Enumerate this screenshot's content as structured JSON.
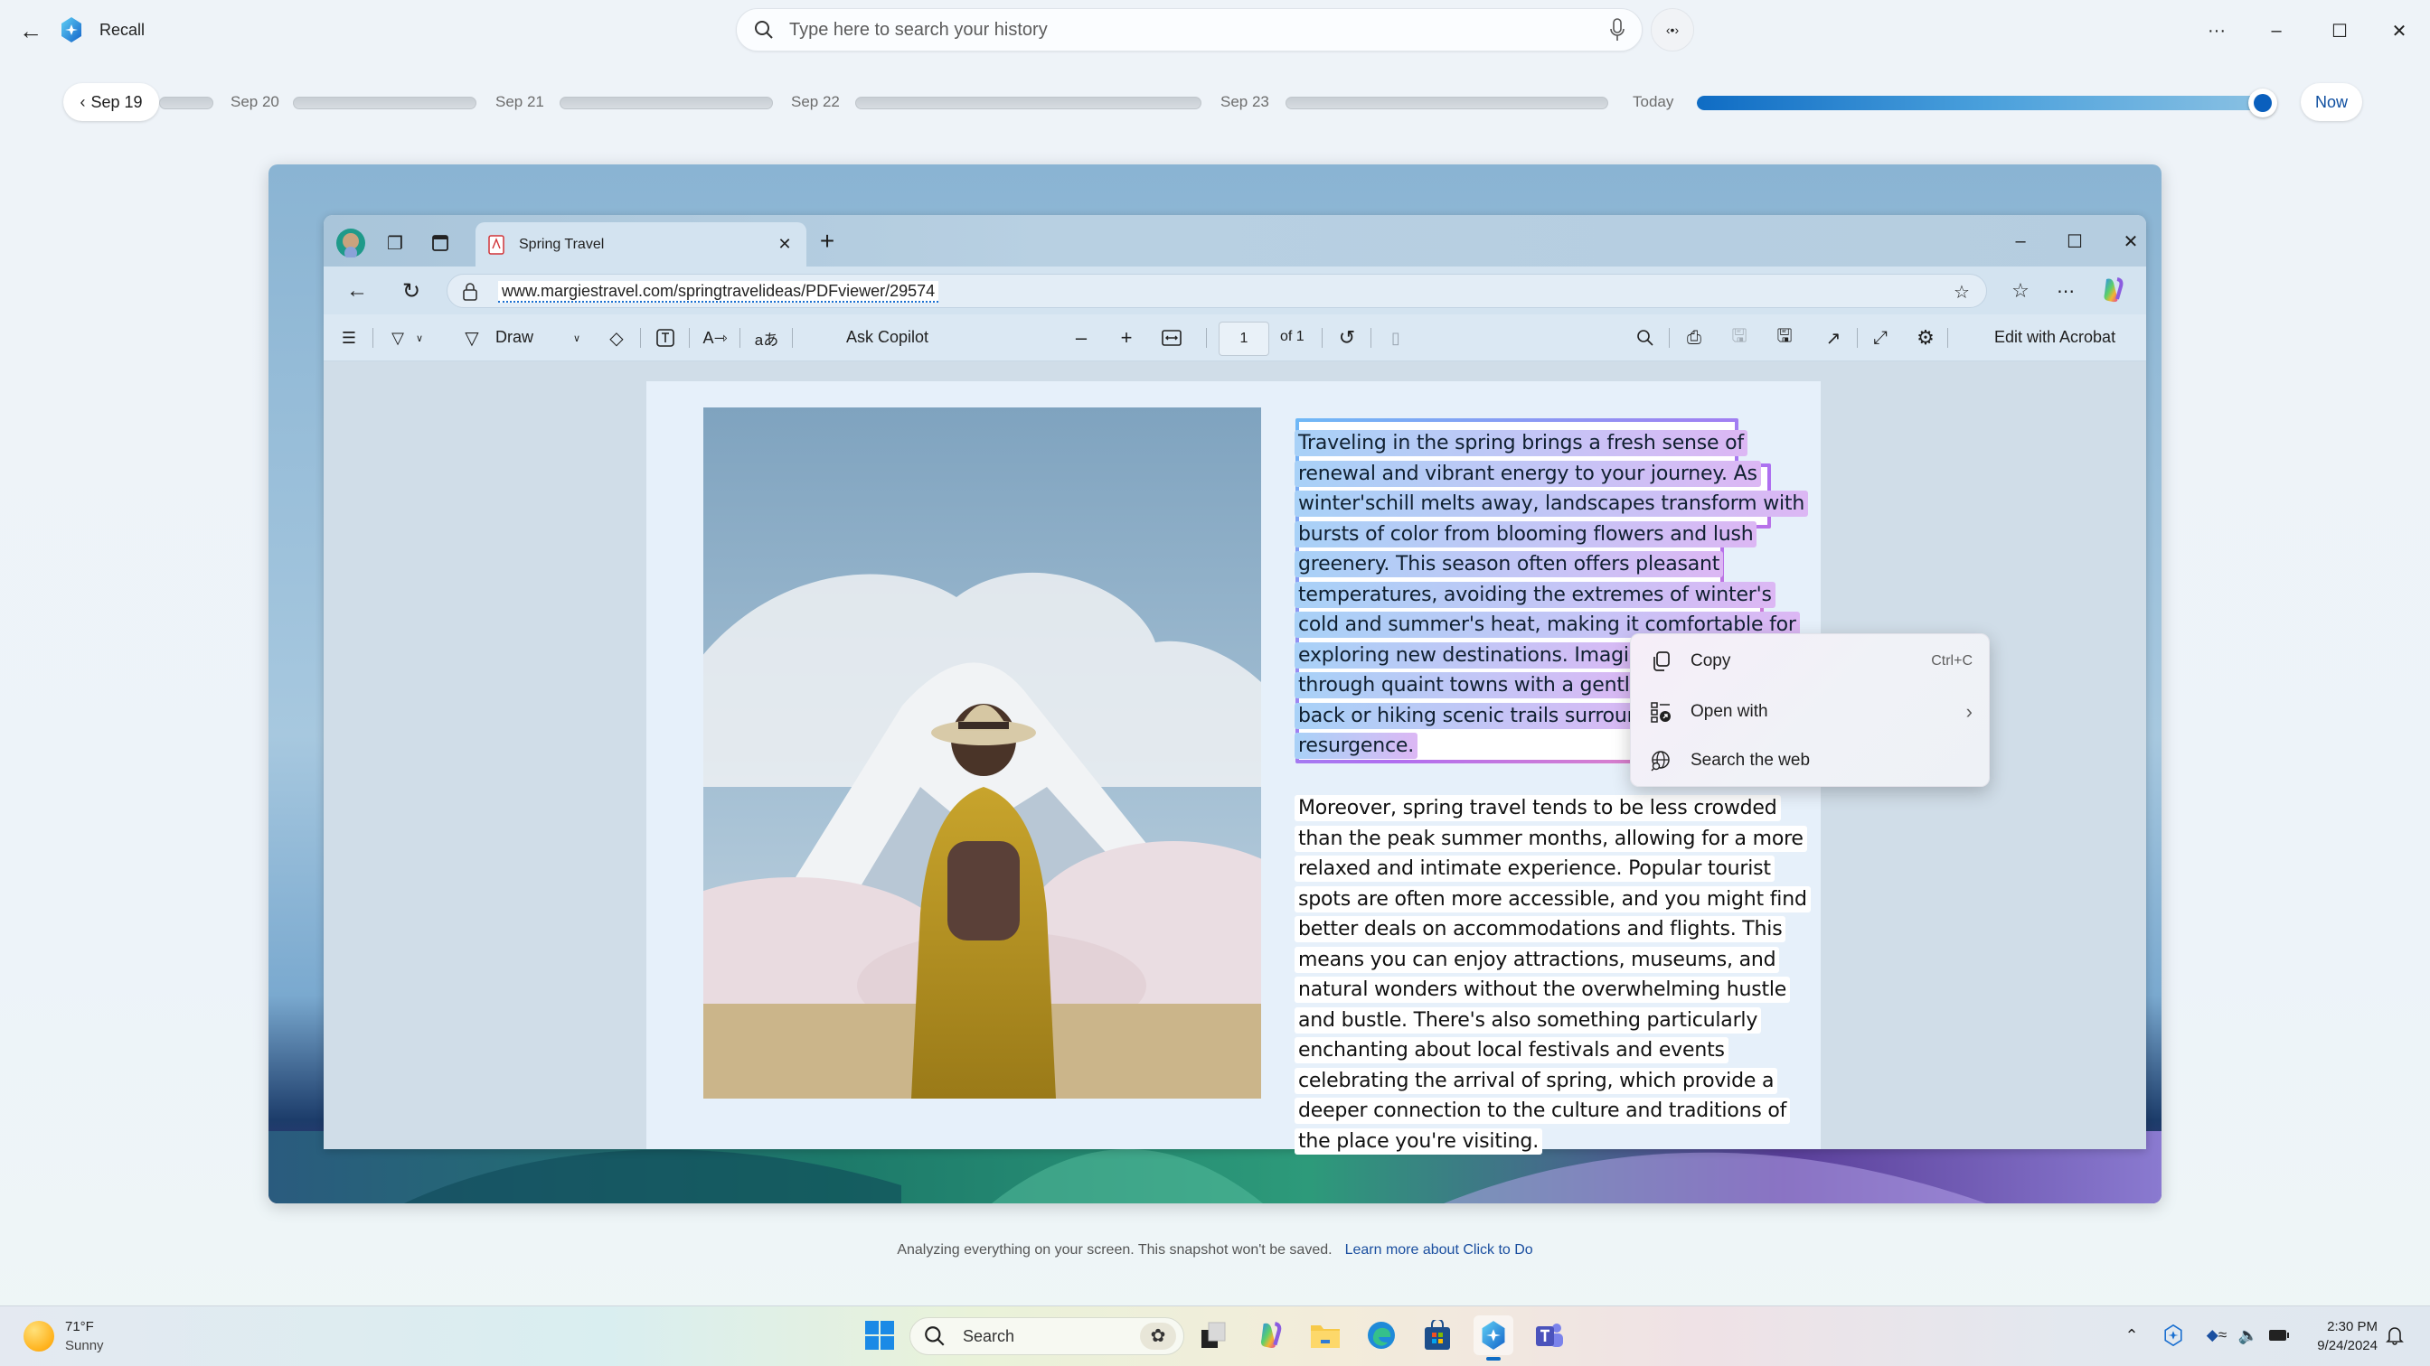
{
  "app": {
    "title": "Recall",
    "back_icon": "arrow-left-icon",
    "logo_icon": "recall-logo-icon"
  },
  "search": {
    "placeholder": "Type here to search your history",
    "value": "",
    "search_icon": "search-icon",
    "mic_icon": "microphone-icon"
  },
  "title_controls": {
    "code_button_icon": "code-brackets-icon",
    "more": "···",
    "minimize": "–",
    "maximize": "☐",
    "close": "✕"
  },
  "timeline": {
    "back_button": "Sep 19",
    "labels": [
      "Sep 20",
      "Sep 21",
      "Sep 22",
      "Sep 23",
      "Today"
    ],
    "today_progress_percent": 100,
    "now_button": "Now"
  },
  "browser": {
    "tab": {
      "title": "Spring Travel",
      "icon": "pdf-file-icon"
    },
    "new_tab": "+",
    "window_controls": {
      "minimize": "–",
      "maximize": "☐",
      "close": "✕"
    },
    "address": {
      "url": "www.margiestravel.com/springtravelideas/PDFviewer/29574"
    },
    "pdf_toolbar": {
      "draw_label": "Draw",
      "ask_copilot_label": "Ask Copilot",
      "zoom_out": "–",
      "zoom_in": "+",
      "page_current": "1",
      "page_total": "of 1",
      "edit_label": "Edit with Acrobat"
    }
  },
  "document": {
    "image_alt": "Traveler with yellow coat and backpack facing a snow-capped mountain behind cherry blossoms",
    "selected_paragraph_lines": [
      "Traveling in the spring brings a fresh sense of",
      "renewal and vibrant energy to your journey. As",
      "winter'schill melts away, landscapes transform with",
      "bursts of color from blooming flowers and lush",
      "greenery. This season often offers pleasant",
      "temperatures, avoiding the extremes of winter's",
      "cold and summer's heat, making it comfortable for",
      "exploring new destinations. Imagine",
      "through quaint towns with a gentle",
      "back or hiking scenic trails surround",
      "resurgence."
    ],
    "second_paragraph_lines": [
      "Moreover, spring travel tends to be less crowded",
      "than the peak summer months, allowing for a more",
      "relaxed and intimate experience. Popular tourist",
      "spots are often more accessible, and you might find",
      "better deals on accommodations and flights. This",
      "means you can enjoy attractions, museums, and",
      "natural wonders without the overwhelming hustle",
      "and bustle. There's also something particularly",
      "enchanting about local festivals and events",
      "celebrating the arrival of spring, which provide a",
      "deeper connection to the culture and traditions of",
      "the place you're visiting."
    ]
  },
  "context_menu": {
    "items": [
      {
        "label": "Copy",
        "shortcut": "Ctrl+C",
        "icon": "copy-icon"
      },
      {
        "label": "Open with",
        "shortcut": "›",
        "icon": "open-with-icon"
      },
      {
        "label": "Search the web",
        "shortcut": "",
        "icon": "globe-search-icon"
      }
    ]
  },
  "footer": {
    "notice": "Analyzing everything on your screen. This snapshot won't be saved.",
    "link": "Learn more about Click to Do"
  },
  "taskbar": {
    "weather": {
      "temp": "71°F",
      "condition": "Sunny"
    },
    "search_label": "Search",
    "apps": [
      "start",
      "task-view",
      "copilot",
      "file-explorer",
      "edge",
      "microsoft-store",
      "recall",
      "teams"
    ],
    "clock": {
      "time": "2:30 PM",
      "date": "9/24/2024"
    }
  },
  "colors": {
    "accent": "#0f6cc4",
    "link": "#1b4fa0",
    "selection_start": "#a8d1f7",
    "selection_end": "#dcb7f4"
  }
}
